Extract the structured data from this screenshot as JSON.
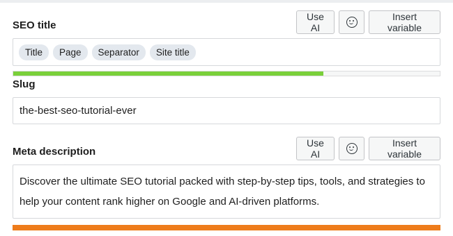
{
  "colors": {
    "title_progress": "#7ad03a",
    "description_progress": "#ee7c1b"
  },
  "seo_title": {
    "label": "SEO title",
    "ai_button": "Use AI",
    "emoji_icon": "smiley-icon",
    "insert_variable": "Insert variable",
    "chips": [
      "Title",
      "Page",
      "Separator",
      "Site title"
    ],
    "progress": 0.727
  },
  "slug": {
    "label": "Slug",
    "value": "the-best-seo-tutorial-ever"
  },
  "meta_description": {
    "label": "Meta description",
    "ai_button": "Use AI",
    "emoji_icon": "smiley-icon",
    "insert_variable": "Insert variable",
    "value": "Discover the ultimate SEO tutorial packed with step-by-step tips, tools, and strategies to help your content rank higher on Google and AI-driven platforms.",
    "progress": 1.0
  }
}
